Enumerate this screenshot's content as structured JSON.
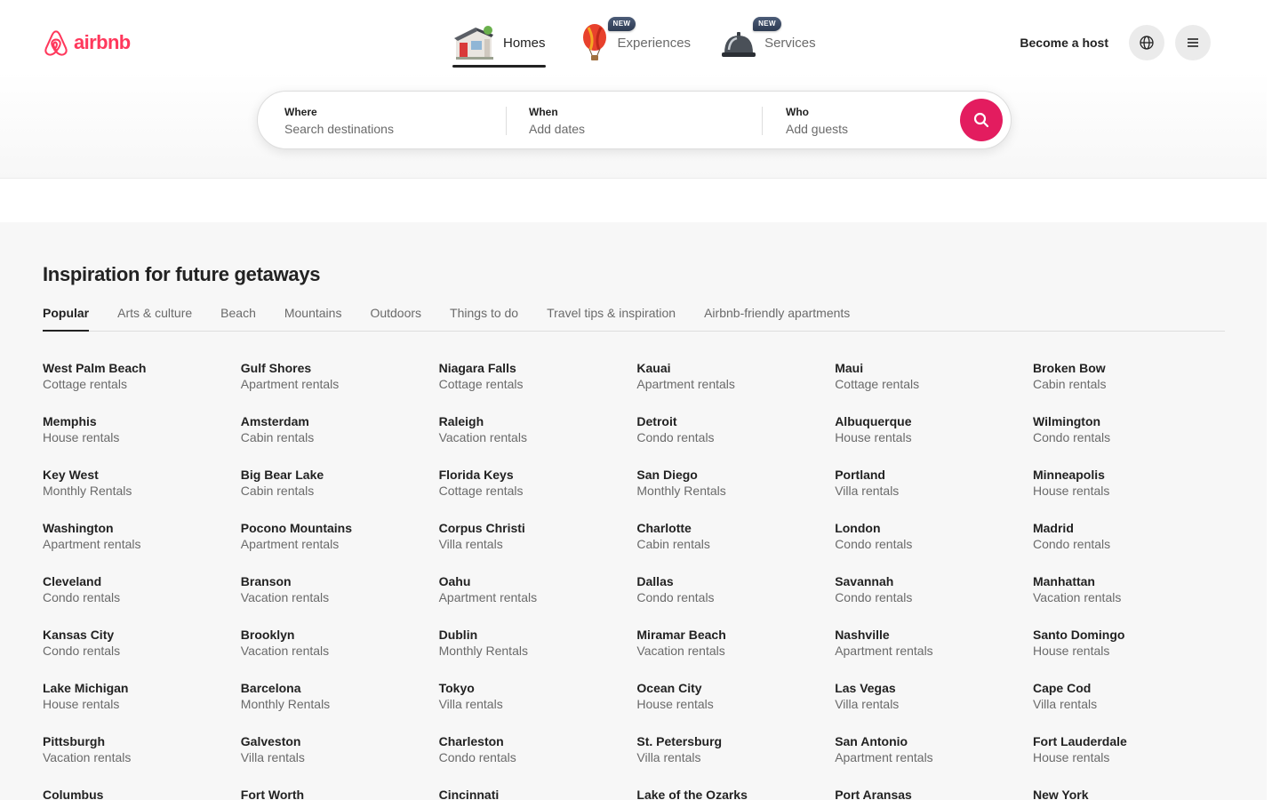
{
  "brand": {
    "name": "airbnb",
    "color": "#FF385C"
  },
  "nav": {
    "tabs": [
      {
        "label": "Homes",
        "icon": "house-icon",
        "active": true,
        "badge": ""
      },
      {
        "label": "Experiences",
        "icon": "hot-air-balloon-icon",
        "active": false,
        "badge": "NEW"
      },
      {
        "label": "Services",
        "icon": "service-bell-icon",
        "active": false,
        "badge": "NEW"
      }
    ]
  },
  "header": {
    "become_host": "Become a host",
    "globe_icon": "globe-icon",
    "menu_icon": "hamburger-menu-icon"
  },
  "search": {
    "where_label": "Where",
    "where_placeholder": "Search destinations",
    "when_label": "When",
    "when_placeholder": "Add dates",
    "who_label": "Who",
    "who_placeholder": "Add guests",
    "button_icon": "search-icon",
    "button_color": "#E31C5F"
  },
  "inspiration": {
    "title": "Inspiration for future getaways",
    "tabs": [
      "Popular",
      "Arts & culture",
      "Beach",
      "Mountains",
      "Outdoors",
      "Things to do",
      "Travel tips & inspiration",
      "Airbnb-friendly apartments"
    ],
    "active_tab": "Popular",
    "destinations": [
      {
        "name": "West Palm Beach",
        "type": "Cottage rentals"
      },
      {
        "name": "Gulf Shores",
        "type": "Apartment rentals"
      },
      {
        "name": "Niagara Falls",
        "type": "Cottage rentals"
      },
      {
        "name": "Kauai",
        "type": "Apartment rentals"
      },
      {
        "name": "Maui",
        "type": "Cottage rentals"
      },
      {
        "name": "Broken Bow",
        "type": "Cabin rentals"
      },
      {
        "name": "Memphis",
        "type": "House rentals"
      },
      {
        "name": "Amsterdam",
        "type": "Cabin rentals"
      },
      {
        "name": "Raleigh",
        "type": "Vacation rentals"
      },
      {
        "name": "Detroit",
        "type": "Condo rentals"
      },
      {
        "name": "Albuquerque",
        "type": "House rentals"
      },
      {
        "name": "Wilmington",
        "type": "Condo rentals"
      },
      {
        "name": "Key West",
        "type": "Monthly Rentals"
      },
      {
        "name": "Big Bear Lake",
        "type": "Cabin rentals"
      },
      {
        "name": "Florida Keys",
        "type": "Cottage rentals"
      },
      {
        "name": "San Diego",
        "type": "Monthly Rentals"
      },
      {
        "name": "Portland",
        "type": "Villa rentals"
      },
      {
        "name": "Minneapolis",
        "type": "House rentals"
      },
      {
        "name": "Washington",
        "type": "Apartment rentals"
      },
      {
        "name": "Pocono Mountains",
        "type": "Apartment rentals"
      },
      {
        "name": "Corpus Christi",
        "type": "Villa rentals"
      },
      {
        "name": "Charlotte",
        "type": "Cabin rentals"
      },
      {
        "name": "London",
        "type": "Condo rentals"
      },
      {
        "name": "Madrid",
        "type": "Condo rentals"
      },
      {
        "name": "Cleveland",
        "type": "Condo rentals"
      },
      {
        "name": "Branson",
        "type": "Vacation rentals"
      },
      {
        "name": "Oahu",
        "type": "Apartment rentals"
      },
      {
        "name": "Dallas",
        "type": "Condo rentals"
      },
      {
        "name": "Savannah",
        "type": "Condo rentals"
      },
      {
        "name": "Manhattan",
        "type": "Vacation rentals"
      },
      {
        "name": "Kansas City",
        "type": "Condo rentals"
      },
      {
        "name": "Brooklyn",
        "type": "Vacation rentals"
      },
      {
        "name": "Dublin",
        "type": "Monthly Rentals"
      },
      {
        "name": "Miramar Beach",
        "type": "Vacation rentals"
      },
      {
        "name": "Nashville",
        "type": "Apartment rentals"
      },
      {
        "name": "Santo Domingo",
        "type": "House rentals"
      },
      {
        "name": "Lake Michigan",
        "type": "House rentals"
      },
      {
        "name": "Barcelona",
        "type": "Monthly Rentals"
      },
      {
        "name": "Tokyo",
        "type": "Villa rentals"
      },
      {
        "name": "Ocean City",
        "type": "House rentals"
      },
      {
        "name": "Las Vegas",
        "type": "Villa rentals"
      },
      {
        "name": "Cape Cod",
        "type": "Villa rentals"
      },
      {
        "name": "Pittsburgh",
        "type": "Vacation rentals"
      },
      {
        "name": "Galveston",
        "type": "Villa rentals"
      },
      {
        "name": "Charleston",
        "type": "Condo rentals"
      },
      {
        "name": "St. Petersburg",
        "type": "Villa rentals"
      },
      {
        "name": "San Antonio",
        "type": "Apartment rentals"
      },
      {
        "name": "Fort Lauderdale",
        "type": "House rentals"
      },
      {
        "name": "Columbus",
        "type": ""
      },
      {
        "name": "Fort Worth",
        "type": ""
      },
      {
        "name": "Cincinnati",
        "type": ""
      },
      {
        "name": "Lake of the Ozarks",
        "type": ""
      },
      {
        "name": "Port Aransas",
        "type": ""
      },
      {
        "name": "New York",
        "type": ""
      }
    ]
  }
}
